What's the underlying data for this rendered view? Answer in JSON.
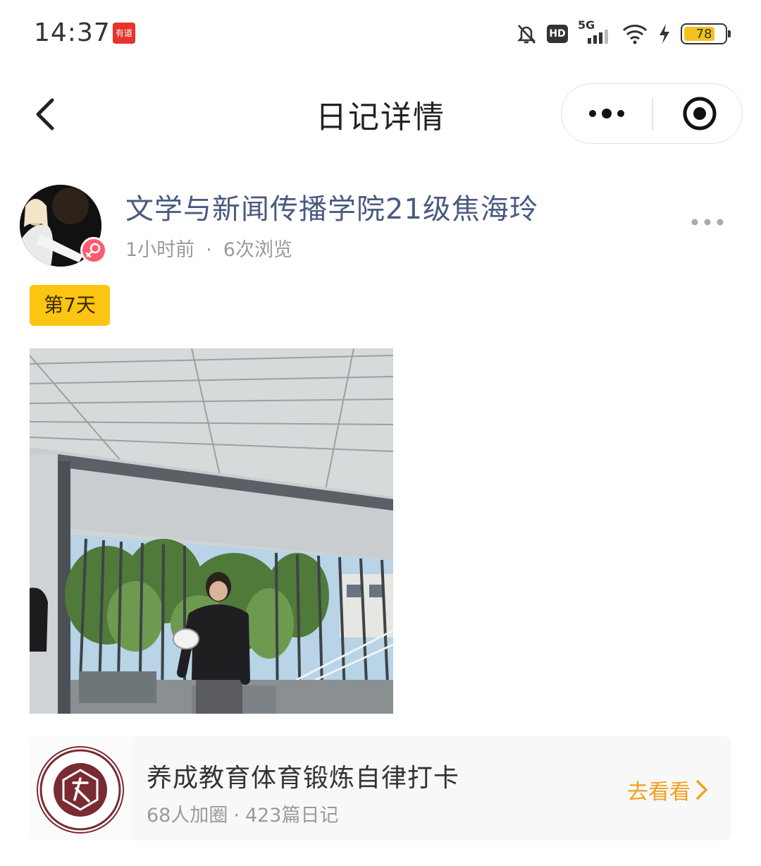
{
  "status_bar": {
    "time": "14:37",
    "app_badge": "有道",
    "network": "5G",
    "hd_label": "HD",
    "battery_level": 78,
    "battery_label": "78"
  },
  "nav": {
    "title": "日记详情",
    "back_icon": "chevron-left-icon",
    "more_icon": "more-dots-icon",
    "close_icon": "target-circle-icon"
  },
  "post": {
    "author": "文学与新闻传播学院21级焦海玲",
    "time_ago": "1小时前",
    "separator": "·",
    "views": "6次浏览",
    "day_tag": "第7天"
  },
  "circle": {
    "name": "养成教育体育锻炼自律打卡",
    "members": "68人加圈",
    "separator": "·",
    "diaries": "423篇日记",
    "action_label": "去看看"
  },
  "colors": {
    "author_name": "#4a5a80",
    "day_tag_bg": "#fcc512",
    "action": "#f0a020",
    "gender_badge": "#ff5a6e",
    "battery_fill": "#f3c21b"
  }
}
